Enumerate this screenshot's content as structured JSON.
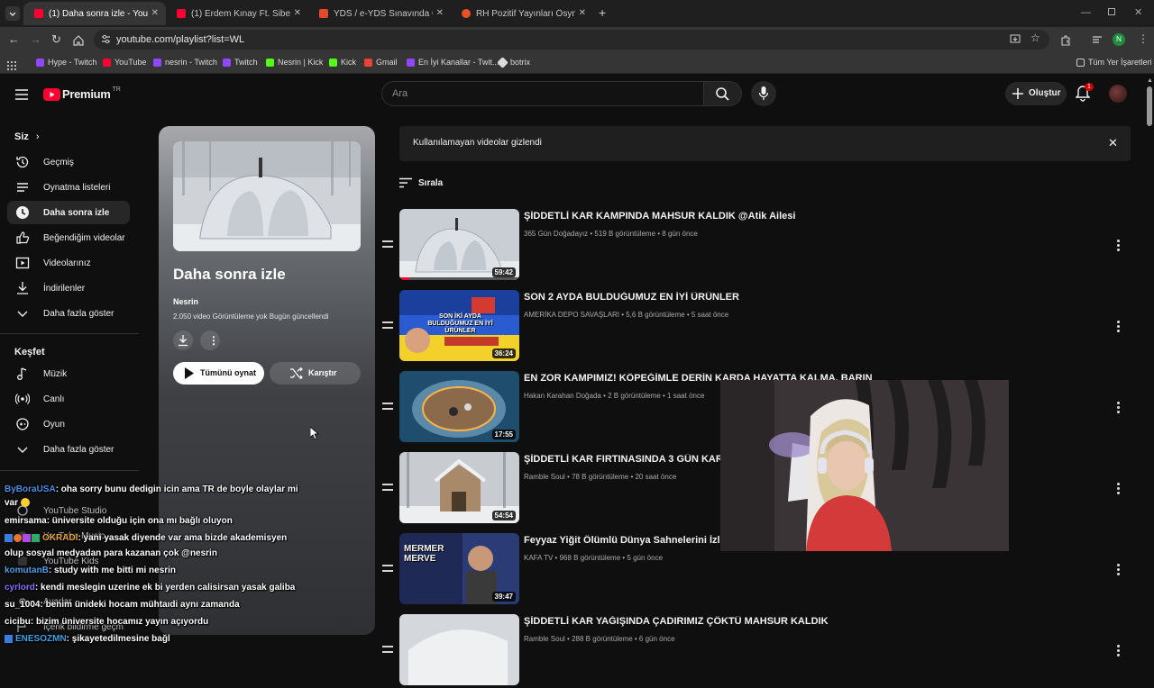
{
  "browser": {
    "tabs": [
      {
        "title": "(1) Daha sonra izle - YouTube",
        "active": true,
        "favicon_color": "#ff0033"
      },
      {
        "title": "(1) Erdem Kınay Ft. Sibel Can - ",
        "active": false,
        "favicon_color": "#ff0033"
      },
      {
        "title": "YDS / e-YDS Sınavında Çıkmış",
        "active": false,
        "favicon_color": "#e24a2b"
      },
      {
        "title": "RH Pozitif Yayınları Ösym Çıkmı",
        "active": false,
        "favicon_color": "#e8502a"
      }
    ],
    "url": "youtube.com/playlist?list=WL",
    "profile_initial": "N",
    "bookmarks": [
      {
        "label": "Hype - Twitch",
        "icon_color": "#9146ff"
      },
      {
        "label": "YouTube",
        "icon_color": "#ff0033"
      },
      {
        "label": "nesrin - Twitch",
        "icon_color": "#9146ff"
      },
      {
        "label": "Twitch",
        "icon_color": "#9146ff"
      },
      {
        "label": "Nesrin | Kick",
        "icon_color": "#53fc18"
      },
      {
        "label": "Kick",
        "icon_color": "#53fc18"
      },
      {
        "label": "Gmail",
        "icon_color": "#ea4335"
      },
      {
        "label": "En İyi Kanallar - Twit...",
        "icon_color": "#9146ff"
      },
      {
        "label": "botrix",
        "icon_color": "#dddddd"
      }
    ],
    "all_bookmarks": "Tüm Yer İşaretleri"
  },
  "header": {
    "logo_text": "Premium",
    "logo_region": "TR",
    "search_placeholder": "Ara",
    "create_label": "Oluştur",
    "notification_count": "1"
  },
  "sidebar": {
    "you_section": "Siz",
    "items": [
      {
        "label": "Geçmiş",
        "icon": "history-icon"
      },
      {
        "label": "Oynatma listeleri",
        "icon": "playlists-icon"
      },
      {
        "label": "Daha sonra izle",
        "icon": "clock-icon",
        "active": true
      },
      {
        "label": "Beğendiğim videolar",
        "icon": "thumbs-up-icon"
      },
      {
        "label": "Videolarınız",
        "icon": "your-videos-icon"
      },
      {
        "label": "İndirilenler",
        "icon": "download-icon"
      },
      {
        "label": "Daha fazla göster",
        "icon": "chevron-down-icon"
      }
    ],
    "explore_section": "Keşfet",
    "explore_items": [
      {
        "label": "Müzik",
        "icon": "music-icon"
      },
      {
        "label": "Canlı",
        "icon": "live-icon"
      },
      {
        "label": "Oyun",
        "icon": "gaming-icon"
      },
      {
        "label": "Daha fazla göster",
        "icon": "chevron-down-icon"
      }
    ],
    "more_items": [
      {
        "label": "YouTube Studio"
      },
      {
        "label": "YouTube Music"
      },
      {
        "label": "YouTube Kids"
      },
      {
        "label": "Ayarlar"
      },
      {
        "label": "İçerik bildirme geçm"
      }
    ]
  },
  "playlist": {
    "title": "Daha sonra izle",
    "owner": "Nesrin",
    "stats": "2.050 video   Görüntüleme yok   Bugün güncellendi",
    "play_all_label": "Tümünü oynat",
    "shuffle_label": "Karıştır"
  },
  "notice": {
    "text": "Kullanılamayan videolar gizlendi"
  },
  "sort_label": "Sırala",
  "videos": [
    {
      "title": "ŞİDDETLİ KAR KAMPINDA MAHSUR KALDIK @Atik Ailesi",
      "channel": "365 Gün Doğadayız",
      "views": "519 B görüntüleme",
      "age": "8 gün önce",
      "duration": "59:42",
      "progress": 0.08
    },
    {
      "title": "SON 2 AYDA BULDUĞUMUZ EN İYİ ÜRÜNLER",
      "channel": "AMERİKA DEPO SAVAŞLARI",
      "views": "5,6 B görüntüleme",
      "age": "5 saat önce",
      "duration": "36:24",
      "thumb_text": "SON İKİ AYDA BULDUĞUMUZ EN İYİ ÜRÜNLER"
    },
    {
      "title": "EN ZOR KAMPIMIZ! KÖPEĞİMLE DERİN KARDA HAYATTA KALMA, BARINAK YOK",
      "channel": "Hakan Karahan Doğada",
      "views": "2 B görüntüleme",
      "age": "1 saat önce",
      "duration": "17:55"
    },
    {
      "title": "ŞİDDETLİ KAR FIRTINASINDA 3 GÜN KAR KAMPI",
      "channel": "Ramble Soul",
      "views": "78 B görüntüleme",
      "age": "20 saat önce",
      "duration": "54:54"
    },
    {
      "title": "Feyyaz Yiğit Ölümlü Dünya Sahnelerini İzledi | Mermer Merve",
      "channel": "KAFA TV",
      "views": "968 B görüntüleme",
      "age": "5 gün önce",
      "duration": "39:47",
      "thumb_text": "MERMER MERVE"
    },
    {
      "title": "ŞİDDETLİ KAR YAĞIŞINDA ÇADIRIMIZ ÇÖKTÜ MAHSUR KALDIK",
      "channel": "Ramble Soul",
      "views": "288 B görüntüleme",
      "age": "6 gün önce",
      "duration": ""
    }
  ],
  "chat": [
    {
      "user": "ByBoraUSA",
      "message": ": oha sorry bunu dedigin icin ama TR de boyle olaylar mi",
      "user_color": "#4a90e2"
    },
    {
      "user": "",
      "message": "var",
      "user_color": "#ffffff"
    },
    {
      "user": "emirsama",
      "message": ": üniversite olduğu için ona mı bağlı oluyon",
      "user_color": "#ffffff"
    },
    {
      "user": "OKRADI",
      "message": ": yani yasak diyende var ama bizde akademisyen",
      "user_color": "#e6a23c"
    },
    {
      "user": "",
      "message": "olup sosyal medyadan para kazanan çok @nesrin",
      "user_color": "#ffffff"
    },
    {
      "user": "komutanB",
      "message": ": study with me bitti mi nesrin",
      "user_color": "#4a9fe8"
    },
    {
      "user": "cyrlord",
      "message": ": kendi meslegin uzerine ek bi yerden calisirsan yasak galiba",
      "user_color": "#8e6cff"
    },
    {
      "user": "su_1004",
      "message": ": benim ünideki hocam mühtaıdi aynı zamanda",
      "user_color": "#ffffff"
    },
    {
      "user": "cicibu",
      "message": ": bizim üniversite hocamız yayın açıyordu",
      "user_color": "#ffffff"
    },
    {
      "user": "ENESOZMN",
      "message": ": şikayetedilmesine bağl",
      "user_color": "#3aa3e3"
    }
  ]
}
